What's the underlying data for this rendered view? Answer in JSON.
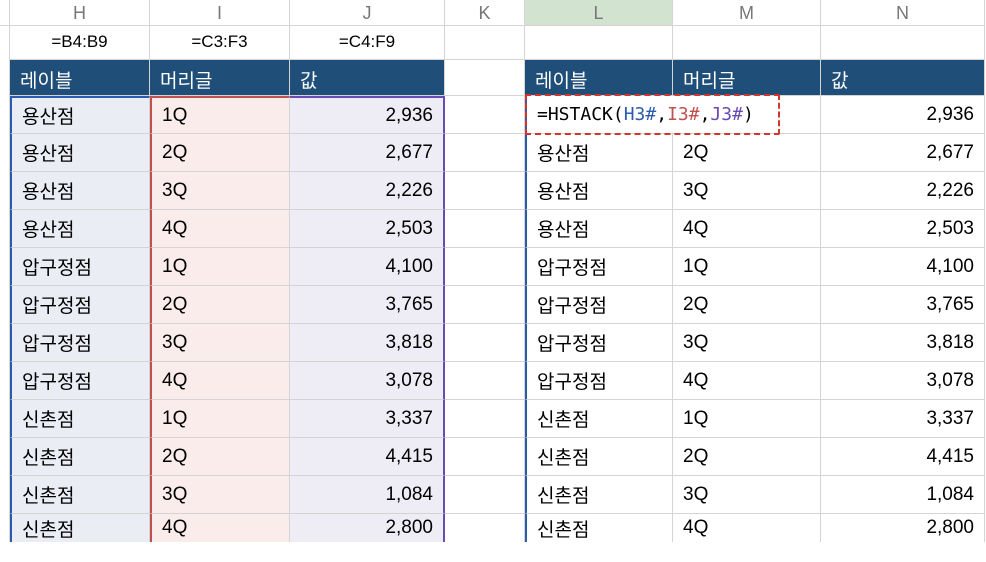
{
  "columns": {
    "H": "H",
    "I": "I",
    "J": "J",
    "K": "K",
    "L": "L",
    "M": "M",
    "N": "N"
  },
  "refs": {
    "h": "=B4:B9",
    "i": "=C3:F3",
    "j": "=C4:F9"
  },
  "headers": {
    "label": "레이블",
    "header": "머리글",
    "value": "값"
  },
  "formula": {
    "eq": "=",
    "fn": "HSTACK(",
    "a1": "H3#",
    "c1": ",",
    "a2": "I3#",
    "c2": ",",
    "a3": "J3#",
    "close": ")"
  },
  "rows": [
    {
      "label": "용산점",
      "hdr": "1Q",
      "val": "2,936"
    },
    {
      "label": "용산점",
      "hdr": "2Q",
      "val": "2,677"
    },
    {
      "label": "용산점",
      "hdr": "3Q",
      "val": "2,226"
    },
    {
      "label": "용산점",
      "hdr": "4Q",
      "val": "2,503"
    },
    {
      "label": "압구정점",
      "hdr": "1Q",
      "val": "4,100"
    },
    {
      "label": "압구정점",
      "hdr": "2Q",
      "val": "3,765"
    },
    {
      "label": "압구정점",
      "hdr": "3Q",
      "val": "3,818"
    },
    {
      "label": "압구정점",
      "hdr": "4Q",
      "val": "3,078"
    },
    {
      "label": "신촌점",
      "hdr": "1Q",
      "val": "3,337"
    },
    {
      "label": "신촌점",
      "hdr": "2Q",
      "val": "4,415"
    },
    {
      "label": "신촌점",
      "hdr": "3Q",
      "val": "1,084"
    },
    {
      "label": "신촌점",
      "hdr": "4Q",
      "val": "2,800"
    }
  ]
}
